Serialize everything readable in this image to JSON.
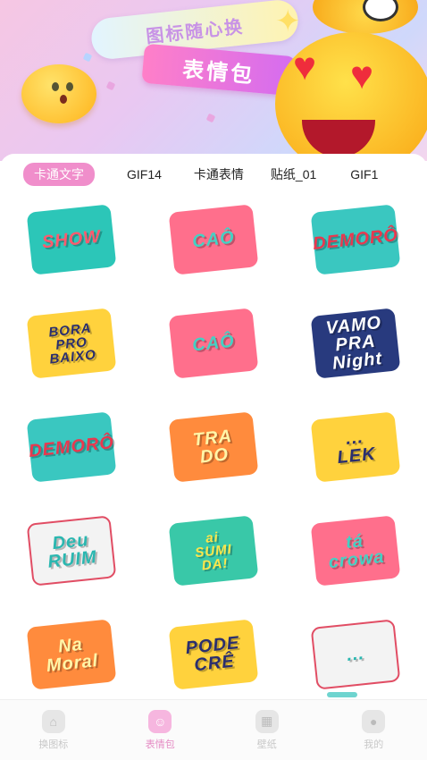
{
  "banner": {
    "title": "图标随心换",
    "subtitle": "表情包"
  },
  "tabs": [
    {
      "label": "卡通文字",
      "active": true
    },
    {
      "label": "GIF14",
      "active": false
    },
    {
      "label": "卡通表情",
      "active": false
    },
    {
      "label": "贴纸_01",
      "active": false
    },
    {
      "label": "GIF1",
      "active": false
    }
  ],
  "stickers": [
    {
      "lines": [
        "SHOW"
      ],
      "icon": "show-sticker-icon",
      "style": "s-teal"
    },
    {
      "lines": [
        "CAÔ"
      ],
      "icon": "cao-glasses-sticker-icon",
      "style": "s-pink"
    },
    {
      "lines": [
        "DEMORÔ"
      ],
      "icon": "demoro-sticker-icon",
      "style": "s-red"
    },
    {
      "lines": [
        "BORA",
        "PRO",
        "BAIXO"
      ],
      "icon": "bora-pro-baixo-sticker-icon",
      "style": "s-yellow"
    },
    {
      "lines": [
        "CAÔ"
      ],
      "icon": "cao-glasses-sticker-icon",
      "style": "s-pink"
    },
    {
      "lines": [
        "VAMO PRA",
        "Night"
      ],
      "icon": "vamo-pra-night-sticker-icon",
      "style": "s-navy"
    },
    {
      "lines": [
        "DEMORÔ"
      ],
      "icon": "demoro-sticker-icon",
      "style": "s-red"
    },
    {
      "lines": [
        "TRA",
        "DO"
      ],
      "icon": "trado-sticker-icon",
      "style": "s-orange"
    },
    {
      "lines": [
        "...",
        "LEK"
      ],
      "icon": "cap-lek-sticker-icon",
      "style": "s-yellow"
    },
    {
      "lines": [
        "Deu",
        "RUIM"
      ],
      "icon": "deu-ruim-sticker-icon",
      "style": "s-white"
    },
    {
      "lines": [
        "ai",
        "SUMI",
        "DA!"
      ],
      "icon": "ai-sumida-sticker-icon",
      "style": "s-lime"
    },
    {
      "lines": [
        "tá",
        "crowa"
      ],
      "icon": "ta-crowa-sticker-icon",
      "style": "s-pink"
    },
    {
      "lines": [
        "Na",
        "Moral"
      ],
      "icon": "na-moral-sticker-icon",
      "style": "s-orange"
    },
    {
      "lines": [
        "PODE",
        "CRÊ"
      ],
      "icon": "pode-cre-hand-sticker-icon",
      "style": "s-yellow"
    },
    {
      "lines": [
        "..."
      ],
      "icon": "text-sticker-icon",
      "style": "s-white"
    }
  ],
  "bottom_nav": [
    {
      "label": "换图标",
      "icon": "home-icon",
      "active": false
    },
    {
      "label": "表情包",
      "icon": "emoji-icon",
      "active": true
    },
    {
      "label": "壁纸",
      "icon": "wallpaper-icon",
      "active": false
    },
    {
      "label": "我的",
      "icon": "profile-icon",
      "active": false
    }
  ],
  "colors": {
    "accent": "#f08ecb",
    "nav_active": "#e58bc4"
  }
}
